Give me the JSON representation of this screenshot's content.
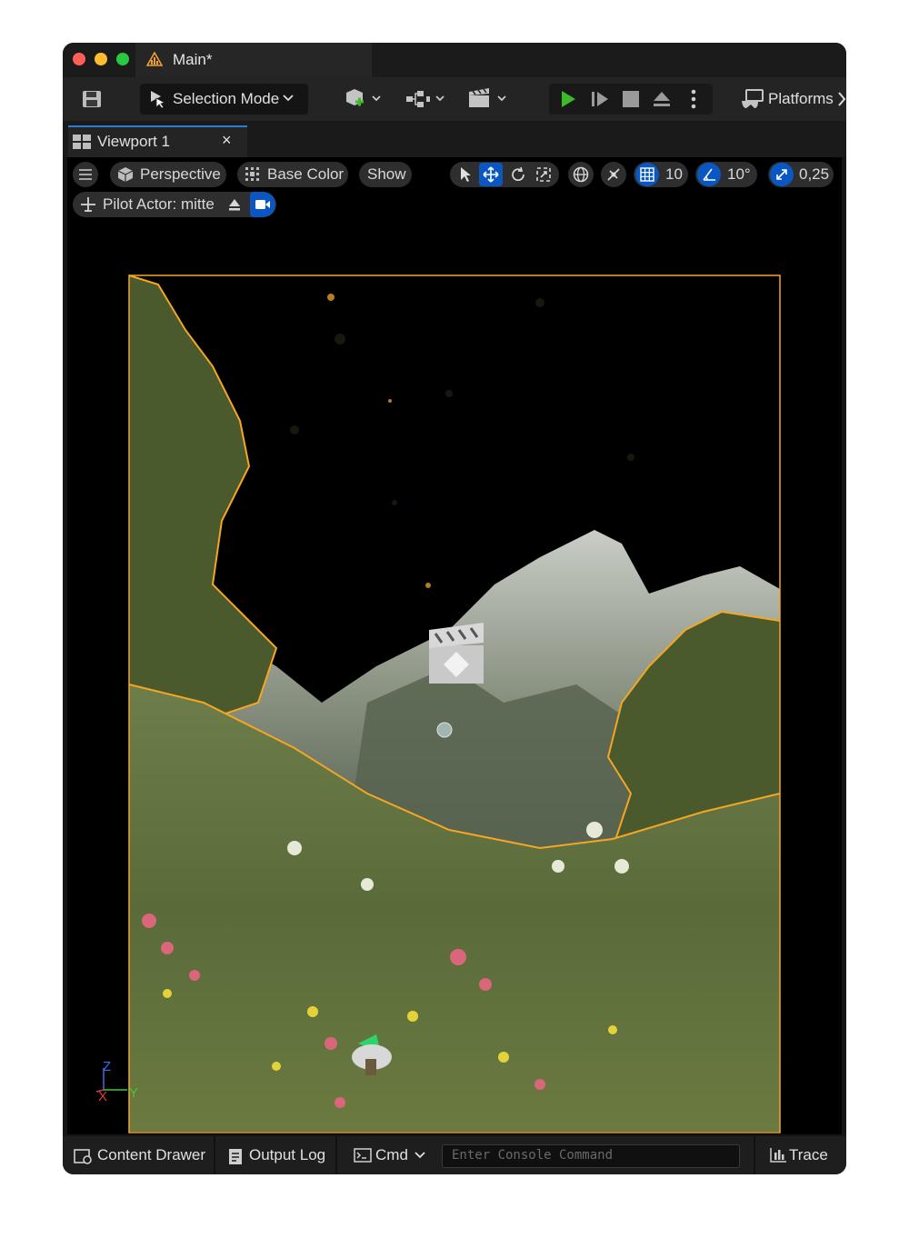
{
  "window": {
    "title": "Main*",
    "colors": {
      "close": "#ff5f57",
      "minimize": "#febc2e",
      "zoom": "#28c840",
      "accent_blue": "#0a56c2",
      "play_green": "#3fba28",
      "selection_orange": "#f5a623"
    }
  },
  "toolbar": {
    "save_icon": "save-icon",
    "selection_mode_label": "Selection Mode",
    "platforms_label": "Platforms"
  },
  "tabs": {
    "viewport_tab_label": "Viewport 1",
    "close_glyph": "×"
  },
  "viewport": {
    "perspective_label": "Perspective",
    "view_mode_label": "Base Color",
    "show_label": "Show",
    "grid_snap_value": "10",
    "rotation_snap_value": "10°",
    "scale_snap_value": "0,25",
    "pilot_label": "Pilot Actor: mitte",
    "axis": {
      "x": "X",
      "y": "Y",
      "z": "Z"
    }
  },
  "statusbar": {
    "content_drawer_label": "Content Drawer",
    "output_log_label": "Output Log",
    "cmd_label": "Cmd",
    "console_placeholder": "Enter Console Command",
    "trace_label": "Trace"
  }
}
